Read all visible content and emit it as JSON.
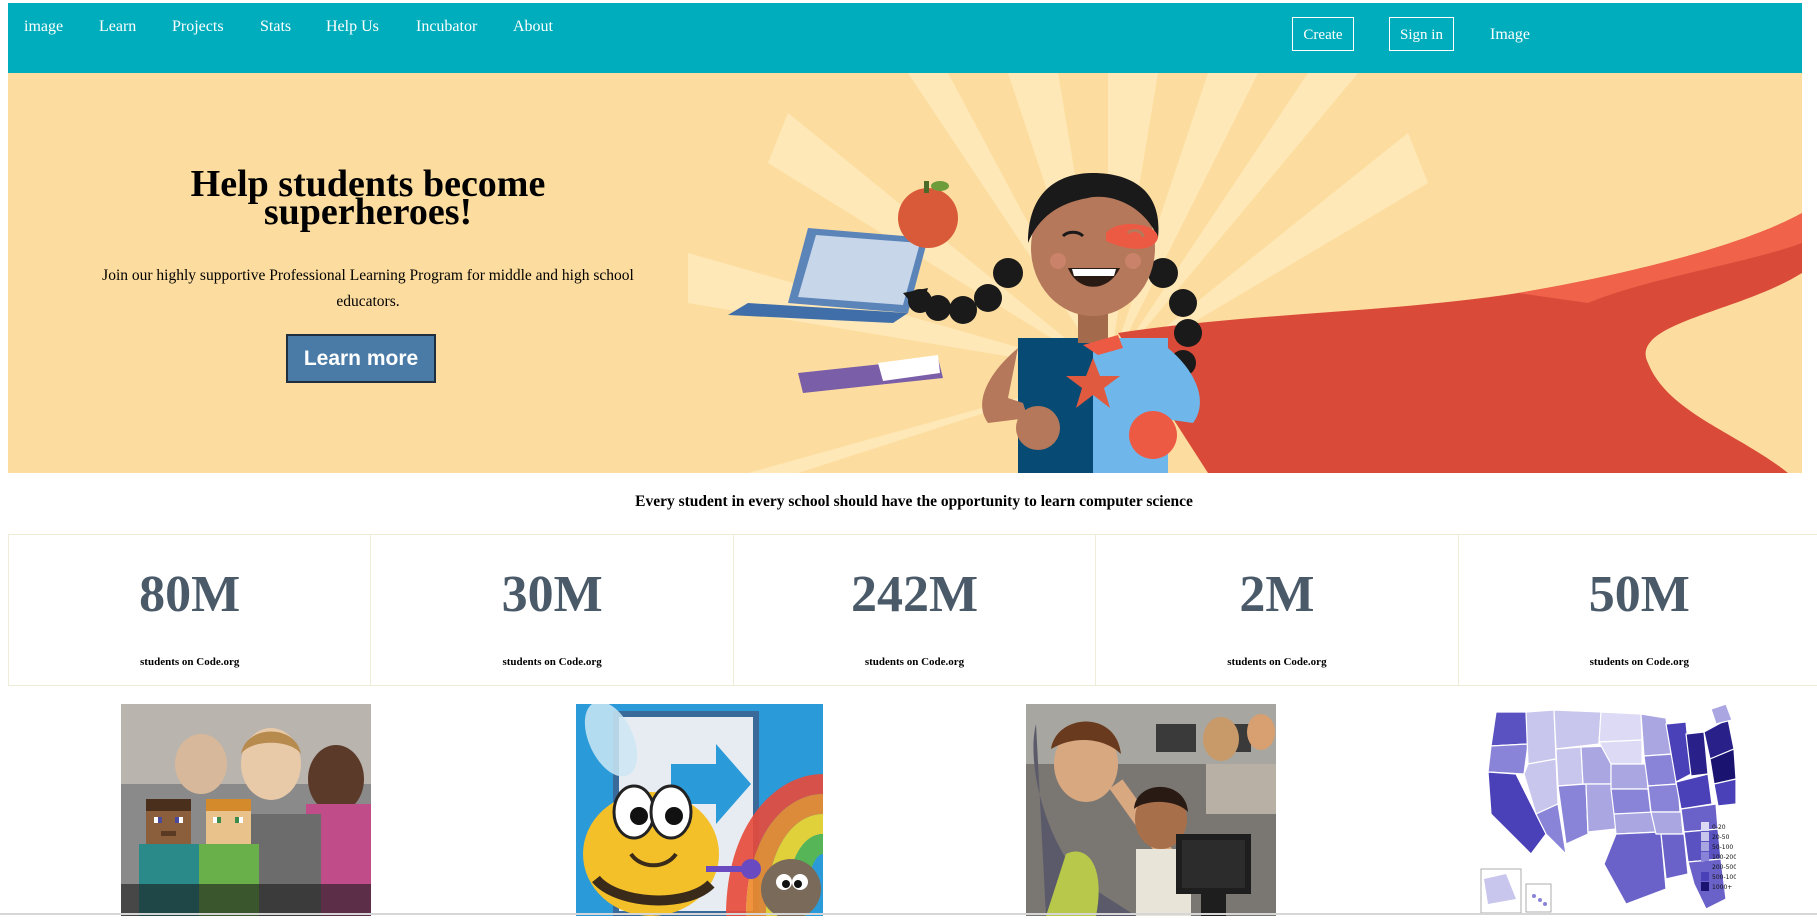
{
  "nav": {
    "logo_text": "image",
    "items": [
      {
        "label": "Learn"
      },
      {
        "label": "Projects"
      },
      {
        "label": "Stats"
      },
      {
        "label": "Help Us"
      },
      {
        "label": "Incubator"
      },
      {
        "label": "About"
      }
    ],
    "create_label": "Create",
    "signin_label": "Sign in",
    "image_label": "Image"
  },
  "hero": {
    "title_line1": "Help students become",
    "title_line2": "superheroes!",
    "subtitle": "Join our highly supportive Professional Learning Program for middle and high school educators.",
    "button_label": "Learn more"
  },
  "tagline": "Every student in every school should have the opportunity to learn computer science",
  "stats": [
    {
      "value": "80M",
      "label": "students on Code.org"
    },
    {
      "value": "30M",
      "label": "students on Code.org"
    },
    {
      "value": "242M",
      "label": "students on Code.org"
    },
    {
      "value": "2M",
      "label": "students on Code.org"
    },
    {
      "value": "50M",
      "label": "students on Code.org"
    }
  ],
  "map_legend": [
    "0-20",
    "20-50",
    "50-100",
    "100-200",
    "200-500",
    "500-1000",
    "1000+"
  ],
  "colors": {
    "nav_bg": "#00adbc",
    "hero_bg": "#fddd9f",
    "button_bg": "#4a7ba7",
    "stat_number": "#4a5a69",
    "cape": "#d94b38"
  }
}
